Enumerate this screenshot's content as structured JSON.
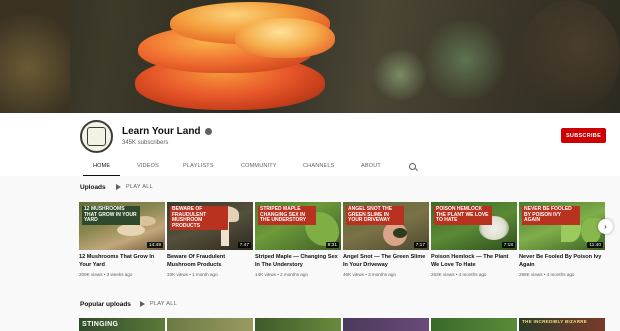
{
  "channel": {
    "name": "Learn Your Land",
    "subscribers": "345K subscribers",
    "subscribe_label": "SUBSCRIBE"
  },
  "tabs": [
    {
      "label": "HOME",
      "active": true
    },
    {
      "label": "VIDEOS",
      "active": false
    },
    {
      "label": "PLAYLISTS",
      "active": false
    },
    {
      "label": "COMMUNITY",
      "active": false
    },
    {
      "label": "CHANNELS",
      "active": false
    },
    {
      "label": "ABOUT",
      "active": false
    }
  ],
  "uploads": {
    "title": "Uploads",
    "play_all": "PLAY ALL",
    "videos": [
      {
        "overlay": "12 MUSHROOMS THAT GROW IN YOUR YARD",
        "duration": "14:49",
        "title": "12 Mushrooms That Grow In Your Yard",
        "meta": "209K views • 3 weeks ago"
      },
      {
        "overlay": "BEWARE OF FRAUDULENT MUSHROOM PRODUCTS",
        "duration": "7:47",
        "title": "Beware Of Fraudulent Mushroom Products",
        "meta": "33K views • 1 month ago"
      },
      {
        "overlay": "STRIPED MAPLE CHANGING SEX IN THE UNDERSTORY",
        "duration": "8:31",
        "title": "Striped Maple — Changing Sex In The Understory",
        "meta": "14K views • 2 months ago"
      },
      {
        "overlay": "ANGEL SNOT THE GREEN SLIME IN YOUR DRIVEWAY",
        "duration": "7:17",
        "title": "Angel Snot — The Green Slime In Your Driveway",
        "meta": "46K views • 3 months ago"
      },
      {
        "overlay": "POISON HEMLOCK THE PLANT WE LOVE TO HATE",
        "duration": "7:18",
        "title": "Poison Hemlock — The Plant We Love To Hate",
        "meta": "263K views • 4 months ago"
      },
      {
        "overlay": "NEVER BE FOOLED BY POISON IVY AGAIN",
        "duration": "11:40",
        "title": "Never Be Fooled By Poison Ivy Again",
        "meta": "298K views • 4 months ago"
      }
    ]
  },
  "popular": {
    "title": "Popular uploads",
    "play_all": "PLAY ALL",
    "thumb_labels": [
      "STINGING",
      "",
      "",
      "",
      "",
      "",
      "THE INCREDIBLY BIZARRE"
    ]
  },
  "colors": {
    "subscribe": "#cc0000",
    "accent_orange": "#e8582a",
    "thumb_label_red": "#b8321f"
  },
  "icons": [
    "verified-icon",
    "search-icon",
    "play-icon",
    "chevron-right-icon"
  ]
}
